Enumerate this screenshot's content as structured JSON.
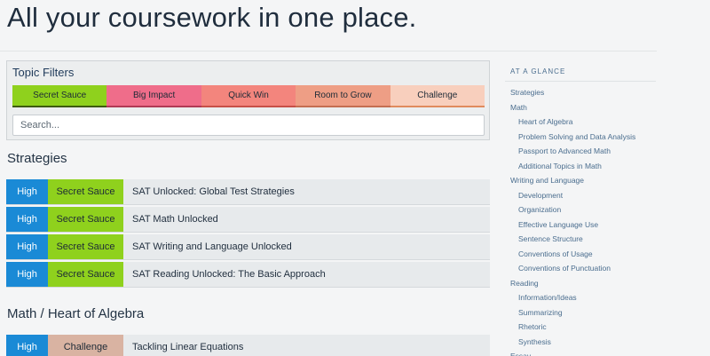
{
  "page": {
    "title": "All your coursework in one place."
  },
  "filters": {
    "title": "Topic Filters",
    "chips": [
      "Secret Sauce",
      "Big Impact",
      "Quick Win",
      "Room to Grow",
      "Challenge"
    ],
    "search_placeholder": "Search..."
  },
  "sections": [
    {
      "heading": "Strategies",
      "rows": [
        {
          "level": "High",
          "category": "Secret Sauce",
          "title": "SAT Unlocked: Global Test Strategies"
        },
        {
          "level": "High",
          "category": "Secret Sauce",
          "title": "SAT Math Unlocked"
        },
        {
          "level": "High",
          "category": "Secret Sauce",
          "title": "SAT Writing and Language Unlocked"
        },
        {
          "level": "High",
          "category": "Secret Sauce",
          "title": "SAT Reading Unlocked: The Basic Approach"
        }
      ]
    },
    {
      "heading": "Math / Heart of Algebra",
      "rows": [
        {
          "level": "High",
          "category": "Challenge",
          "title": "Tackling Linear Equations"
        }
      ]
    }
  ],
  "sidebar": {
    "heading": "AT A GLANCE",
    "items": [
      "Strategies",
      "Math",
      "Heart of Algebra",
      "Problem Solving and Data Analysis",
      "Passport to Advanced Math",
      "Additional Topics in Math",
      "Writing and Language",
      "Development",
      "Organization",
      "Effective Language Use",
      "Sentence Structure",
      "Conventions of Usage",
      "Conventions of Punctuation",
      "Reading",
      "Information/Ideas",
      "Summarizing",
      "Rhetoric",
      "Synthesis",
      "Essay"
    ]
  },
  "colors": {
    "secret_sauce": "#8fd11d",
    "big_impact": "#ef6d8a",
    "quick_win": "#f3857d",
    "room_to_grow": "#ee9e85",
    "challenge": "#f8cfbd",
    "level_high": "#1a8ad6"
  }
}
